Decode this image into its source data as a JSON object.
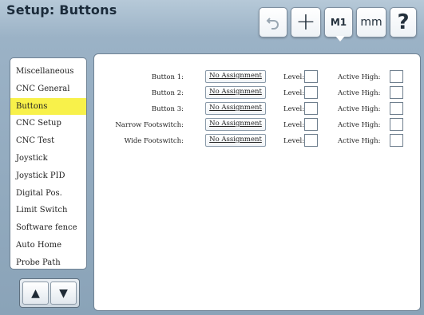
{
  "window": {
    "title": "Setup: Buttons"
  },
  "toolbar": {
    "undo_icon": "undo-icon",
    "plus_label": "+",
    "m1_label": "M1",
    "mm_label": "mm",
    "help_label": "?"
  },
  "sidebar": {
    "items": [
      {
        "label": "Miscellaneous",
        "active": false
      },
      {
        "label": "CNC General",
        "active": false
      },
      {
        "label": "Buttons",
        "active": true
      },
      {
        "label": "CNC Setup",
        "active": false
      },
      {
        "label": "CNC Test",
        "active": false
      },
      {
        "label": "Joystick",
        "active": false
      },
      {
        "label": "Joystick PID",
        "active": false
      },
      {
        "label": "Digital Pos.",
        "active": false
      },
      {
        "label": "Limit Switch",
        "active": false
      },
      {
        "label": "Software fence",
        "active": false
      },
      {
        "label": "Auto Home",
        "active": false
      },
      {
        "label": "Probe Path",
        "active": false
      }
    ],
    "active_color": "#f8f14a"
  },
  "scroll": {
    "up_icon": "arrow-up-icon",
    "down_icon": "arrow-down-icon",
    "up_glyph": "▲",
    "down_glyph": "▼"
  },
  "buttons_table": {
    "level_label": "Level:",
    "active_high_label": "Active High:",
    "rows": [
      {
        "label": "Button 1:",
        "assignment": "No Assignment",
        "level": false,
        "active_high": false
      },
      {
        "label": "Button 2:",
        "assignment": "No Assignment",
        "level": false,
        "active_high": false
      },
      {
        "label": "Button 3:",
        "assignment": "No Assignment",
        "level": false,
        "active_high": false
      },
      {
        "label": "Narrow Footswitch:",
        "assignment": "No Assignment",
        "level": false,
        "active_high": false
      },
      {
        "label": "Wide Footswitch:",
        "assignment": "No Assignment",
        "level": false,
        "active_high": false
      }
    ]
  }
}
